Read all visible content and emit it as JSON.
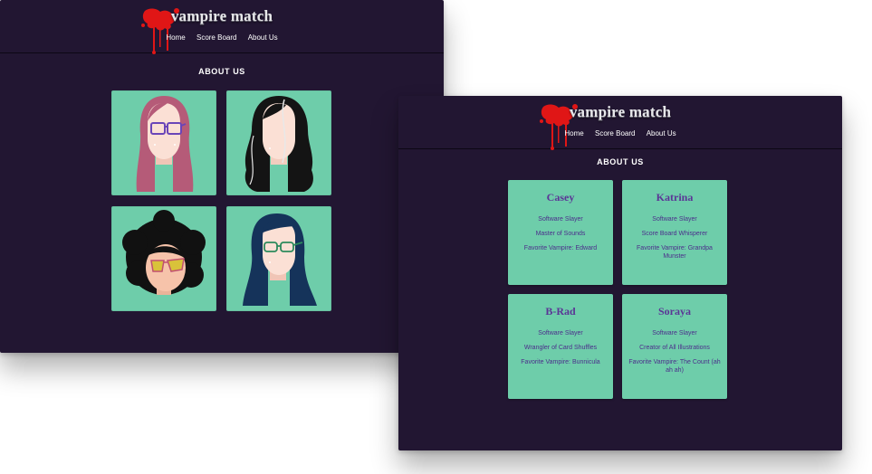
{
  "site": {
    "logo": "vampire match",
    "nav": [
      "Home",
      "Score Board",
      "About Us"
    ]
  },
  "about": {
    "title": "ABOUT US"
  },
  "team": [
    {
      "name": "Casey",
      "lines": [
        "Software Slayer",
        "Master of Sounds",
        "Favorite Vampire: Edward"
      ]
    },
    {
      "name": "Katrina",
      "lines": [
        "Software Slayer",
        "Score Board Whisperer",
        "Favorite Vampire: Grandpa Munster"
      ]
    },
    {
      "name": "B-Rad",
      "lines": [
        "Software Slayer",
        "Wrangler of Card Shuffles",
        "Favorite Vampire: Bunnicula"
      ]
    },
    {
      "name": "Soraya",
      "lines": [
        "Software Slayer",
        "Creator of All Illustrations",
        "Favorite Vampire: The Count (ah ah ah)"
      ]
    }
  ],
  "colors": {
    "background": "#221632",
    "card": "#6ecdaa",
    "text_purple": "#4c2d8b",
    "blood": "#e01616"
  }
}
